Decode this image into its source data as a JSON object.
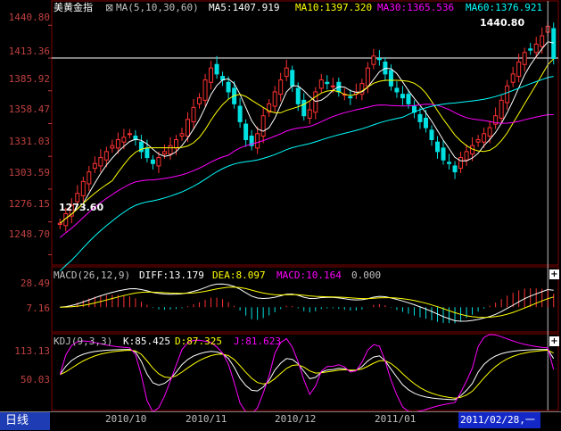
{
  "instrument": {
    "name": "美黄金指"
  },
  "main_panel": {
    "ma_params": "MA(5,10,30,60)",
    "ma5": "MA5:1407.919",
    "ma10": "MA10:1397.320",
    "ma30": "MA30:1365.536",
    "ma60": "MA60:1376.921",
    "y_ticks": [
      "1440.80",
      "1413.36",
      "1385.92",
      "1358.47",
      "1331.03",
      "1303.59",
      "1276.15",
      "1248.70"
    ],
    "high_label": "1440.80",
    "low_label": "1273.60"
  },
  "macd_panel": {
    "params": "MACD(26,12,9)",
    "diff": "DIFF:13.179",
    "dea": "DEA:8.097",
    "macd": "MACD:10.164",
    "zero": "0.000",
    "y_ticks": [
      "28.49",
      "7.16"
    ]
  },
  "kdj_panel": {
    "params": "KDJ(9,3,3)",
    "k": "K:85.425",
    "d": "D:87.325",
    "j": "J:81.623",
    "y_ticks": [
      "113.13",
      "50.03"
    ]
  },
  "bottom_bar": {
    "period_label": "日线",
    "dates": [
      "2010/10",
      "2010/11",
      "2010/12",
      "2011/01"
    ],
    "cursor_date": "2011/02/28,一"
  },
  "colors": {
    "up": "#ff3232",
    "down": "#00e0e0",
    "ma5": "#ffffff",
    "ma10": "#ffff00",
    "ma30": "#ff00ff",
    "ma60": "#00ffff",
    "axis_text": "#c04040",
    "grid": "#800000"
  },
  "chart_data": {
    "type": "candlestick",
    "title": "美黄金指",
    "x_labels": [
      "2010/10",
      "2010/11",
      "2010/12",
      "2011/01"
    ],
    "ylim": [
      1240,
      1450
    ],
    "high": 1440.8,
    "low": 1273.6,
    "last_close": 1413.4,
    "approx_closes": [
      1275,
      1283,
      1290,
      1300,
      1310,
      1318,
      1325,
      1330,
      1335,
      1340,
      1345,
      1347,
      1350,
      1345,
      1335,
      1330,
      1325,
      1330,
      1335,
      1340,
      1345,
      1350,
      1362,
      1372,
      1380,
      1395,
      1405,
      1400,
      1395,
      1385,
      1375,
      1360,
      1345,
      1340,
      1350,
      1365,
      1375,
      1385,
      1395,
      1405,
      1390,
      1375,
      1365,
      1370,
      1385,
      1395,
      1392,
      1390,
      1385,
      1383,
      1380,
      1385,
      1392,
      1405,
      1415,
      1412,
      1400,
      1390,
      1385,
      1380,
      1375,
      1368,
      1360,
      1355,
      1345,
      1335,
      1328,
      1325,
      1318,
      1330,
      1335,
      1340,
      1345,
      1350,
      1355,
      1365,
      1378,
      1390,
      1400,
      1410,
      1418,
      1420,
      1425,
      1432,
      1440,
      1413
    ]
  }
}
